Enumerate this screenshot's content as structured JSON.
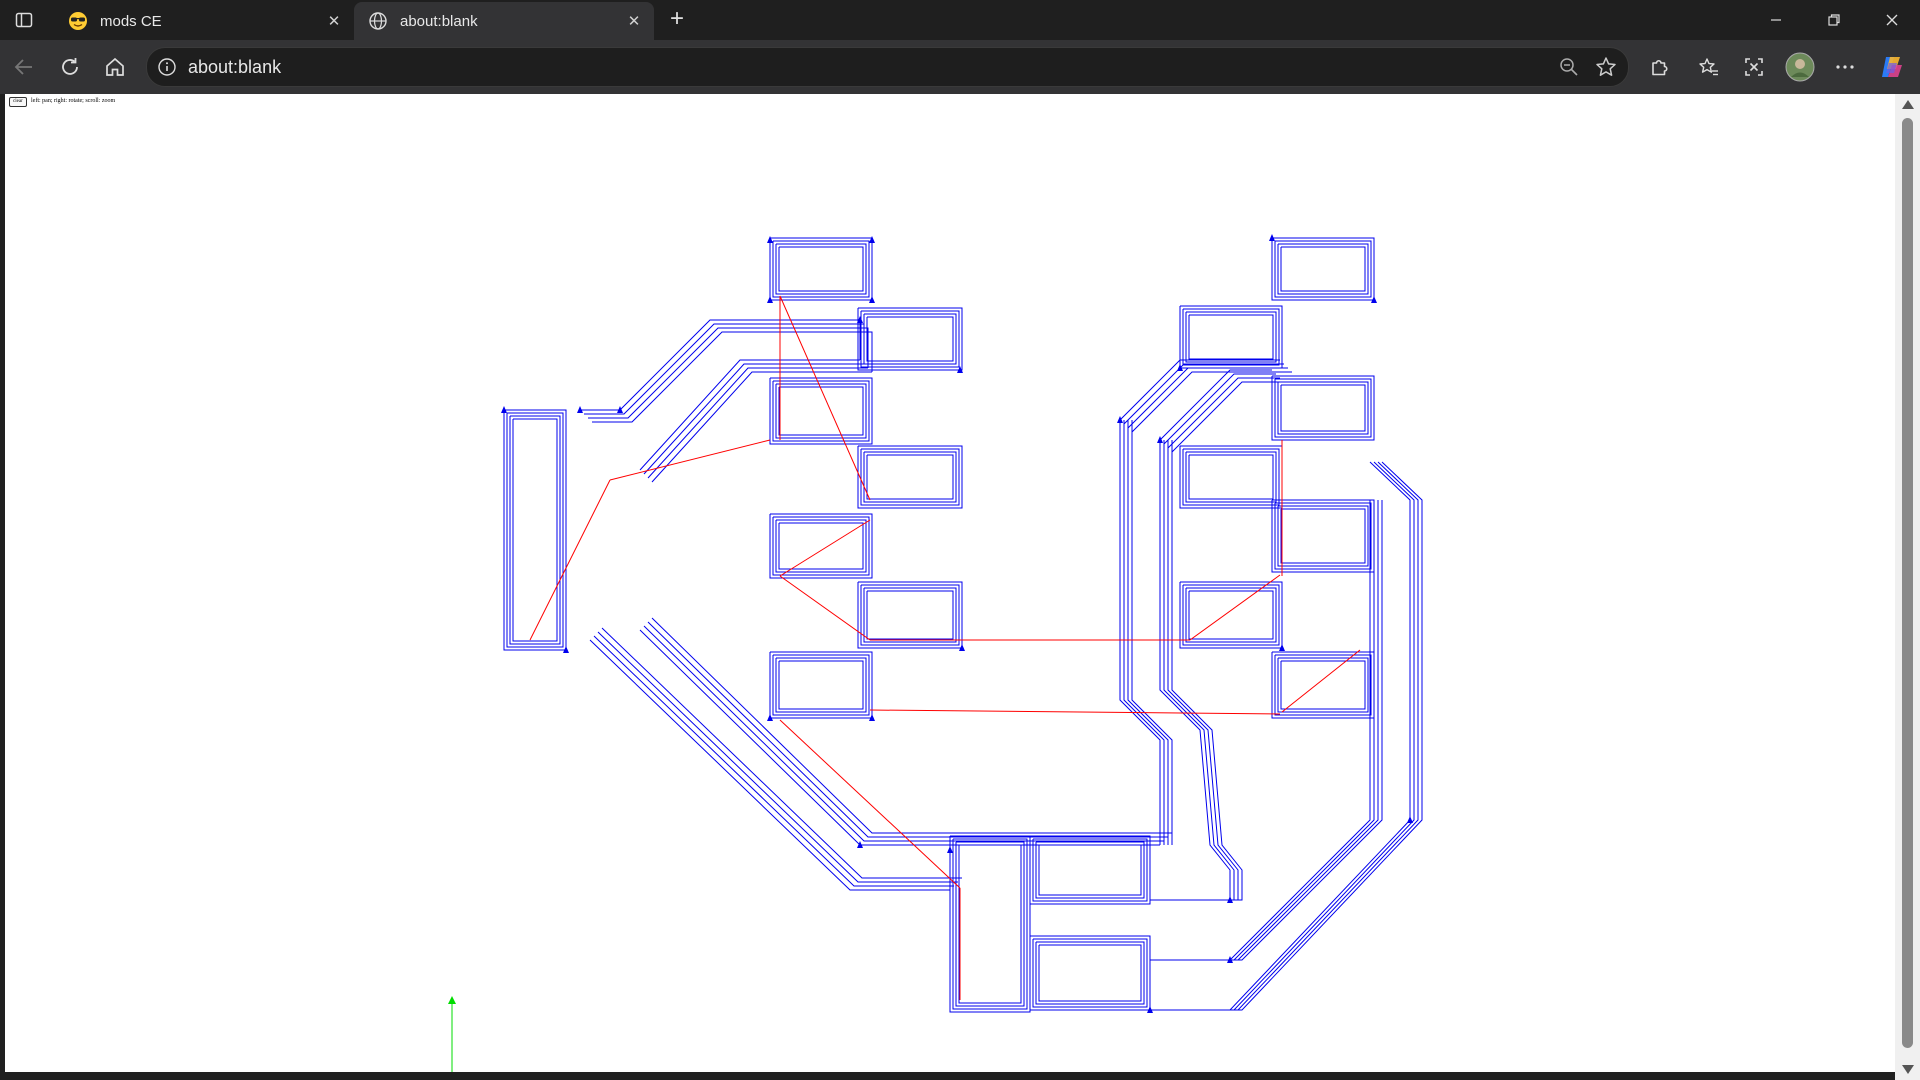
{
  "browser": {
    "tabs": [
      {
        "title": "mods CE",
        "active": false
      },
      {
        "title": "about:blank",
        "active": true
      }
    ],
    "address": "about:blank"
  },
  "page": {
    "clear_label": "clear",
    "help_text": "left: pan; right: rotate; scroll: zoom"
  },
  "colors": {
    "cut_path": "#0000ee",
    "travel_move": "#ff0000",
    "axis": "#00dd00"
  }
}
